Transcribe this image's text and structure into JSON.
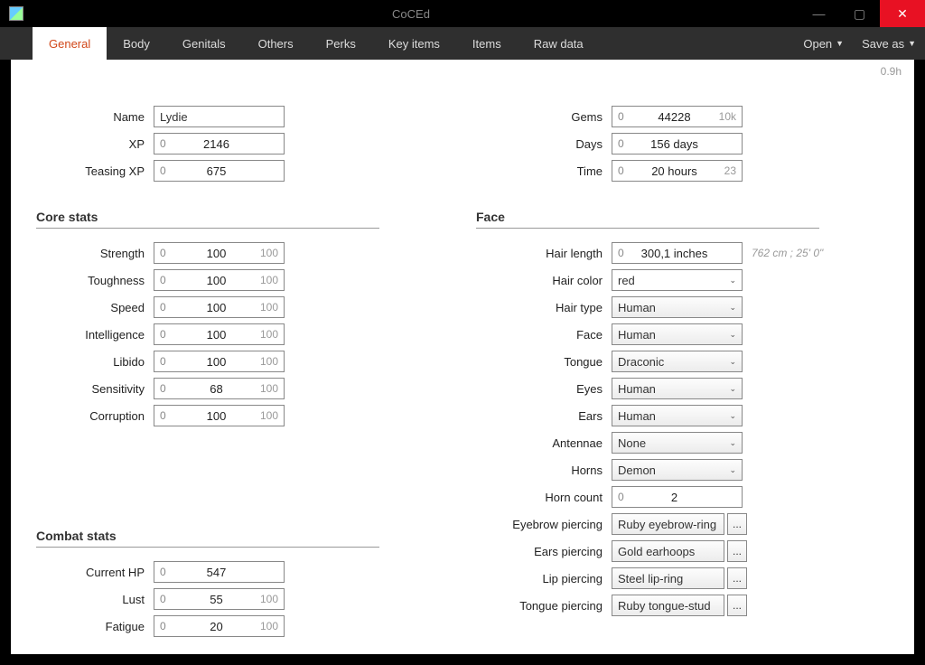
{
  "window": {
    "title": "CoCEd"
  },
  "tabs": [
    "General",
    "Body",
    "Genitals",
    "Others",
    "Perks",
    "Key items",
    "Items",
    "Raw data"
  ],
  "active_tab": 0,
  "menu": {
    "open": "Open",
    "saveas": "Save as"
  },
  "version": "0.9h",
  "basic": {
    "name": {
      "label": "Name",
      "value": "Lydie"
    },
    "xp": {
      "label": "XP",
      "min": "0",
      "value": "2146"
    },
    "teasing_xp": {
      "label": "Teasing XP",
      "min": "0",
      "value": "675"
    }
  },
  "status": {
    "gems": {
      "label": "Gems",
      "min": "0",
      "value": "44228",
      "max": "10k"
    },
    "days": {
      "label": "Days",
      "min": "0",
      "value": "156 days"
    },
    "time": {
      "label": "Time",
      "min": "0",
      "value": "20 hours",
      "max": "23"
    }
  },
  "core_title": "Core stats",
  "core": [
    {
      "label": "Strength",
      "min": "0",
      "value": "100",
      "max": "100"
    },
    {
      "label": "Toughness",
      "min": "0",
      "value": "100",
      "max": "100"
    },
    {
      "label": "Speed",
      "min": "0",
      "value": "100",
      "max": "100"
    },
    {
      "label": "Intelligence",
      "min": "0",
      "value": "100",
      "max": "100"
    },
    {
      "label": "Libido",
      "min": "0",
      "value": "100",
      "max": "100"
    },
    {
      "label": "Sensitivity",
      "min": "0",
      "value": "68",
      "max": "100"
    },
    {
      "label": "Corruption",
      "min": "0",
      "value": "100",
      "max": "100"
    }
  ],
  "combat_title": "Combat stats",
  "combat": [
    {
      "label": "Current HP",
      "min": "0",
      "value": "547",
      "max": ""
    },
    {
      "label": "Lust",
      "min": "0",
      "value": "55",
      "max": "100"
    },
    {
      "label": "Fatigue",
      "min": "0",
      "value": "20",
      "max": "100"
    }
  ],
  "face_title": "Face",
  "face": {
    "hair_length": {
      "label": "Hair length",
      "min": "0",
      "value": "300,1 inches",
      "hint": "762 cm ; 25' 0\""
    },
    "hair_color": {
      "label": "Hair color",
      "value": "red"
    },
    "hair_type": {
      "label": "Hair type",
      "value": "Human"
    },
    "face": {
      "label": "Face",
      "value": "Human"
    },
    "tongue": {
      "label": "Tongue",
      "value": "Draconic"
    },
    "eyes": {
      "label": "Eyes",
      "value": "Human"
    },
    "ears": {
      "label": "Ears",
      "value": "Human"
    },
    "antennae": {
      "label": "Antennae",
      "value": "None"
    },
    "horns": {
      "label": "Horns",
      "value": "Demon"
    },
    "horn_count": {
      "label": "Horn count",
      "min": "0",
      "value": "2"
    },
    "eyebrow_piercing": {
      "label": "Eyebrow piercing",
      "value": "Ruby eyebrow-ring"
    },
    "ears_piercing": {
      "label": "Ears piercing",
      "value": "Gold earhoops"
    },
    "lip_piercing": {
      "label": "Lip piercing",
      "value": "Steel lip-ring"
    },
    "tongue_piercing": {
      "label": "Tongue piercing",
      "value": "Ruby tongue-stud"
    }
  },
  "ellipsis": "..."
}
